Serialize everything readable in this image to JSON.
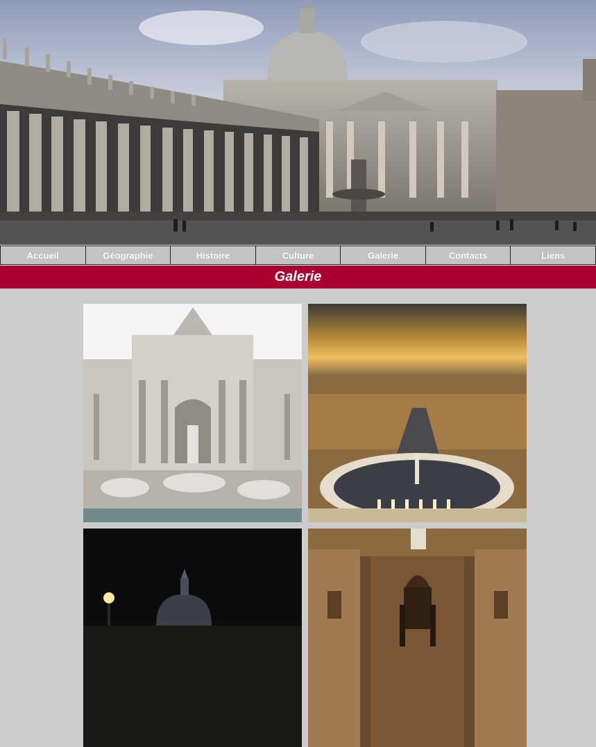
{
  "hero": {
    "image": "st-peters-square-colonnade-photo"
  },
  "nav": {
    "items": [
      {
        "label": "Accueil"
      },
      {
        "label": "Géographie"
      },
      {
        "label": "Histoire"
      },
      {
        "label": "Culture"
      },
      {
        "label": "Galerie"
      },
      {
        "label": "Contacts"
      },
      {
        "label": "Liens"
      }
    ]
  },
  "page": {
    "title": "Galerie"
  },
  "gallery": {
    "images": [
      {
        "subject": "trevi-fountain-photo"
      },
      {
        "subject": "st-peters-square-aerial-sunset-photo"
      },
      {
        "subject": "st-peters-dome-night-photo"
      },
      {
        "subject": "basilica-interior-baldachin-photo"
      }
    ]
  },
  "colors": {
    "title_bar": "#a8002f",
    "nav_button": "#c3c3c3",
    "page_background": "#cccccc"
  }
}
